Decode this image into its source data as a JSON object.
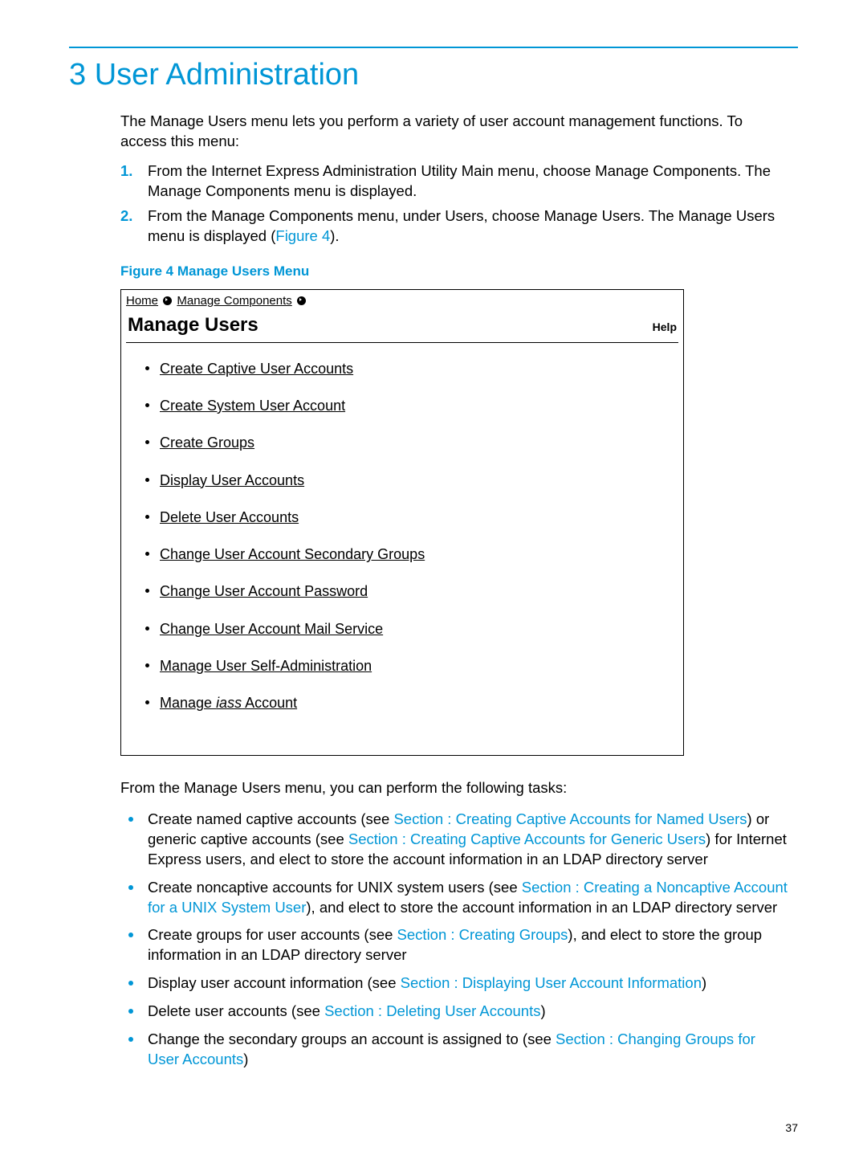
{
  "chapter": {
    "number": "3",
    "title": "User Administration"
  },
  "intro": "The Manage Users menu lets you perform a variety of user account management functions. To access this menu:",
  "steps": [
    {
      "num": "1.",
      "text": "From the Internet Express Administration Utility Main menu, choose Manage Components. The Manage Components menu is displayed."
    },
    {
      "num": "2.",
      "text_prefix": "From the Manage Components menu, under Users, choose Manage Users. The Manage Users menu is displayed (",
      "link": "Figure 4",
      "text_suffix": ")."
    }
  ],
  "figure": {
    "caption": "Figure 4 Manage Users Menu",
    "breadcrumb": {
      "home": "Home",
      "components": "Manage Components"
    },
    "header": "Manage Users",
    "help": "Help",
    "items": [
      "Create Captive User Accounts",
      "Create System User Account",
      "Create Groups",
      "Display User Accounts",
      "Delete User Accounts",
      "Change User Account Secondary Groups",
      "Change User Account Password",
      "Change User Account Mail Service",
      "Manage User Self-Administration"
    ],
    "iass_item_prefix": "Manage ",
    "iass_item_em": "iass",
    "iass_item_suffix": " Account"
  },
  "tasks_intro": "From the Manage Users menu, you can perform the following tasks:",
  "tasks": [
    {
      "segments": [
        {
          "t": "Create named captive accounts (see "
        },
        {
          "t": "Section : Creating Captive Accounts for Named Users",
          "link": true
        },
        {
          "t": ") or generic captive accounts (see "
        },
        {
          "t": "Section : Creating Captive Accounts for Generic Users",
          "link": true
        },
        {
          "t": ") for Internet Express users, and elect to store the account information in an LDAP directory server"
        }
      ]
    },
    {
      "segments": [
        {
          "t": "Create noncaptive accounts for UNIX system users (see "
        },
        {
          "t": "Section : Creating a Noncaptive Account for a UNIX System User",
          "link": true
        },
        {
          "t": "), and elect to store the account information in an LDAP directory server"
        }
      ]
    },
    {
      "segments": [
        {
          "t": "Create groups for user accounts (see "
        },
        {
          "t": "Section : Creating Groups",
          "link": true
        },
        {
          "t": "), and elect to store the group information in an LDAP directory server"
        }
      ]
    },
    {
      "segments": [
        {
          "t": "Display user account information (see "
        },
        {
          "t": "Section : Displaying User Account Information",
          "link": true
        },
        {
          "t": ")"
        }
      ]
    },
    {
      "segments": [
        {
          "t": "Delete user accounts (see "
        },
        {
          "t": "Section : Deleting User Accounts",
          "link": true
        },
        {
          "t": ")"
        }
      ]
    },
    {
      "segments": [
        {
          "t": "Change the secondary groups an account is assigned to (see "
        },
        {
          "t": "Section : Changing Groups for User Accounts",
          "link": true
        },
        {
          "t": ")"
        }
      ]
    }
  ],
  "page_number": "37"
}
